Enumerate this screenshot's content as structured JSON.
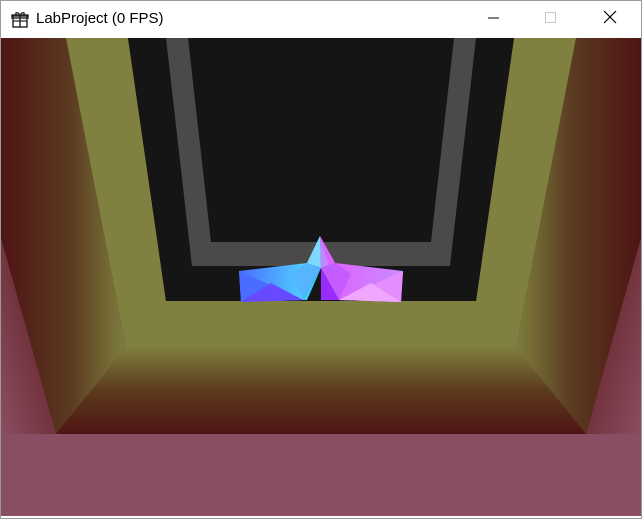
{
  "window": {
    "title": "LabProject (0 FPS)",
    "icon": "gift-icon"
  },
  "caption_buttons": {
    "minimize_icon": "minimize-icon",
    "maximize_icon": "maximize-icon",
    "close_icon": "close-icon"
  },
  "scene": {
    "object": "star-shaped-polygon",
    "colors": {
      "background": "#151515",
      "inner_frame": "#4a4a4a",
      "corridor_yellow": "#808040",
      "corridor_dark_red": "#4e1414",
      "floor_mauve": "#8a4e62",
      "star_cyan": "#52e6ff",
      "star_magenta": "#e05cff",
      "star_blue": "#4a6cff"
    }
  }
}
